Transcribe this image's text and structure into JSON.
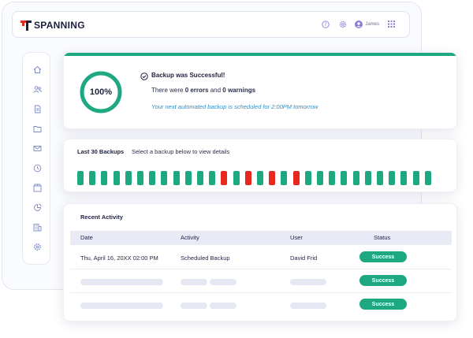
{
  "header": {
    "logo_text": "SPANNING",
    "user_name": "James",
    "icons": [
      "help-icon",
      "gear-icon",
      "user-avatar-icon",
      "apps-grid-icon"
    ]
  },
  "sidebar": {
    "icons": [
      "home-icon",
      "users-icon",
      "document-icon",
      "folder-icon",
      "mail-icon",
      "clock-icon",
      "box-icon",
      "chart-icon",
      "building-icon",
      "settings-icon"
    ]
  },
  "status": {
    "progress_label": "100%",
    "progress_value": 1.0,
    "title": "Backup was Successful!",
    "summary_prefix": "There were ",
    "errors": "0 errors",
    "summary_mid": " and ",
    "warnings": "0 warnings",
    "next_backup": "Your next automated backup is scheduled for 2:00PM tomorrow",
    "accent_color": "#1ea882"
  },
  "backups": {
    "title": "Last 30 Backups",
    "subtitle": "Select a backup below to view details",
    "success_color": "#1ea882",
    "failure_color": "#e8271f",
    "results": [
      "success",
      "success",
      "success",
      "success",
      "success",
      "success",
      "success",
      "success",
      "success",
      "success",
      "success",
      "success",
      "failure",
      "success",
      "failure",
      "success",
      "failure",
      "success",
      "failure",
      "success",
      "success",
      "success",
      "success",
      "success",
      "success",
      "success",
      "success",
      "success",
      "success",
      "success"
    ]
  },
  "activity": {
    "title": "Recent Activity",
    "columns": [
      "Date",
      "Activity",
      "User",
      "Status"
    ],
    "rows": [
      {
        "date": "Thu, April 16, 20XX 02:00 PM",
        "activity": "Scheduled Backup",
        "user": "David Frid",
        "status": "Success"
      },
      {
        "date": "",
        "activity": "",
        "user": "",
        "status": "Success"
      },
      {
        "date": "",
        "activity": "",
        "user": "",
        "status": "Success"
      }
    ]
  }
}
